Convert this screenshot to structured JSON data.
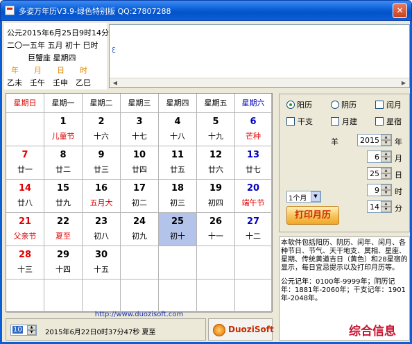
{
  "window": {
    "title": "多姿万年历V3.9-绿色特别版 QQ:27807288",
    "close_label": "✕"
  },
  "info": {
    "line1": "公元2015年6月25日9时14分",
    "line2": "二〇一五年 五月 初十 巳时",
    "line3": "巨蟹座  星期四",
    "ganzhi_headers": [
      "年",
      "月",
      "日",
      "时"
    ],
    "ganzhi_values": [
      "乙未",
      "壬午",
      "壬申",
      "乙巳"
    ]
  },
  "memo": {
    "text": ""
  },
  "calendar": {
    "weekdays": [
      "星期日",
      "星期一",
      "星期二",
      "星期三",
      "星期四",
      "星期五",
      "星期六"
    ],
    "weekday_colors": [
      "#e00000",
      "#000000",
      "#000000",
      "#000000",
      "#000000",
      "#000000",
      "#0000c0"
    ],
    "rows": [
      [
        {
          "day": "",
          "lunar": ""
        },
        {
          "day": "1",
          "lunar": "儿童节",
          "lunar_color": "red"
        },
        {
          "day": "2",
          "lunar": "十六"
        },
        {
          "day": "3",
          "lunar": "十七"
        },
        {
          "day": "4",
          "lunar": "十八"
        },
        {
          "day": "5",
          "lunar": "十九"
        },
        {
          "day": "6",
          "lunar": "芒种",
          "day_color": "blue",
          "lunar_color": "red"
        }
      ],
      [
        {
          "day": "7",
          "lunar": "廿一",
          "day_color": "red"
        },
        {
          "day": "8",
          "lunar": "廿二"
        },
        {
          "day": "9",
          "lunar": "廿三"
        },
        {
          "day": "10",
          "lunar": "廿四"
        },
        {
          "day": "11",
          "lunar": "廿五"
        },
        {
          "day": "12",
          "lunar": "廿六"
        },
        {
          "day": "13",
          "lunar": "廿七",
          "day_color": "blue"
        }
      ],
      [
        {
          "day": "14",
          "lunar": "廿八",
          "day_color": "red"
        },
        {
          "day": "15",
          "lunar": "廿九"
        },
        {
          "day": "16",
          "lunar": "五月大",
          "lunar_color": "red"
        },
        {
          "day": "17",
          "lunar": "初二"
        },
        {
          "day": "18",
          "lunar": "初三"
        },
        {
          "day": "19",
          "lunar": "初四"
        },
        {
          "day": "20",
          "lunar": "端午节",
          "day_color": "blue",
          "lunar_color": "red"
        }
      ],
      [
        {
          "day": "21",
          "lunar": "父亲节",
          "day_color": "red",
          "lunar_color": "red"
        },
        {
          "day": "22",
          "lunar": "夏至",
          "lunar_color": "red"
        },
        {
          "day": "23",
          "lunar": "初八"
        },
        {
          "day": "24",
          "lunar": "初九"
        },
        {
          "day": "25",
          "lunar": "初十",
          "selected": true
        },
        {
          "day": "26",
          "lunar": "十一"
        },
        {
          "day": "27",
          "lunar": "十二",
          "day_color": "blue"
        }
      ],
      [
        {
          "day": "28",
          "lunar": "十三",
          "day_color": "red"
        },
        {
          "day": "29",
          "lunar": "十四"
        },
        {
          "day": "30",
          "lunar": "十五"
        },
        {
          "day": "",
          "lunar": ""
        },
        {
          "day": "",
          "lunar": ""
        },
        {
          "day": "",
          "lunar": ""
        },
        {
          "day": "",
          "lunar": ""
        }
      ],
      [
        {
          "day": "",
          "lunar": ""
        },
        {
          "day": "",
          "lunar": ""
        },
        {
          "day": "",
          "lunar": ""
        },
        {
          "day": "",
          "lunar": ""
        },
        {
          "day": "",
          "lunar": ""
        },
        {
          "day": "",
          "lunar": ""
        },
        {
          "day": "",
          "lunar": ""
        }
      ]
    ]
  },
  "url": "http://www.duozisoft.com",
  "bottom": {
    "spin_value": "10",
    "text": "2015年6月22日0时37分47秒 夏至"
  },
  "logo": {
    "text": "DuoziSoft"
  },
  "controls": {
    "radio_solar": "阳历",
    "radio_lunar": "阴历",
    "chk_leap": "闰月",
    "chk_ganzhi": "干支",
    "chk_yuejian": "月建",
    "chk_xingxiu": "星宿",
    "sheep": "羊",
    "year_value": "2015",
    "year_label": "年",
    "month_value": "6",
    "month_label": "月",
    "day_value": "25",
    "day_label": "日",
    "hour_value": "9",
    "hour_label": "时",
    "minute_value": "14",
    "minute_label": "分",
    "range_value": "1个月",
    "print_label": "打印月历"
  },
  "description": {
    "para1": "本软件包括阳历、阴历、闰年、闰月、各种节日、节气、天干地支、属相、星座、星期、传统黄道吉日（黄色）和28星宿的显示，每日宜忌提示以及打印月历等。",
    "para2": "公元记年：0100年-9999年；阴历记年：1881年-2060年；干支记年：1901年-2048年。"
  },
  "watermark": "综合信息"
}
